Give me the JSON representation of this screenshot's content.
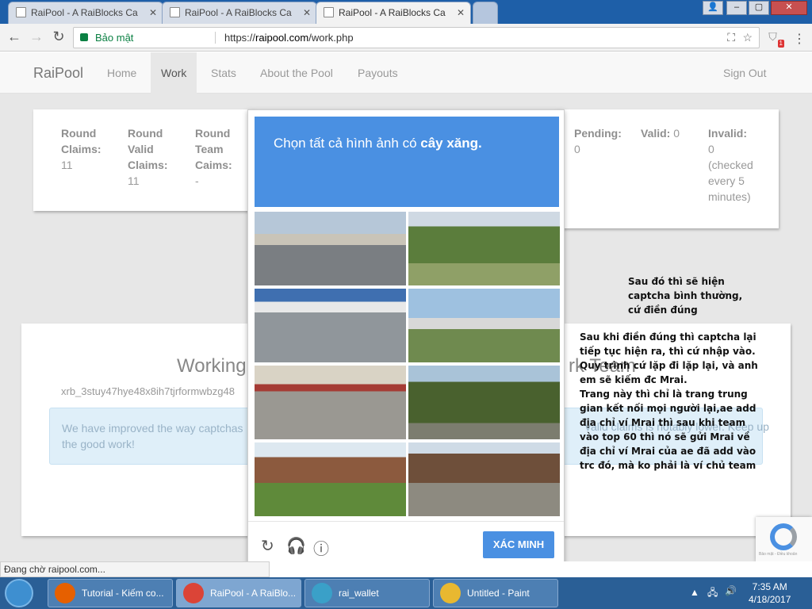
{
  "tabs": [
    {
      "title": "RaiPool - A RaiBlocks Ca"
    },
    {
      "title": "RaiPool - A RaiBlocks Ca"
    },
    {
      "title": "RaiPool - A RaiBlocks Ca"
    }
  ],
  "omnibox": {
    "secure_label": "Bảo mật",
    "url_scheme": "https://",
    "url_host": "raipool.com",
    "url_path": "/work.php",
    "ext_badge": "1"
  },
  "site": {
    "brand": "RaiPool",
    "nav": [
      "Home",
      "Work",
      "Stats",
      "About the Pool",
      "Payouts"
    ],
    "sign_out": "Sign Out"
  },
  "stats_left": [
    {
      "label": "Round Claims:",
      "value": "11"
    },
    {
      "label": "Round Valid Claims:",
      "value": "11"
    },
    {
      "label": "Round Team Caims:",
      "value": "-"
    }
  ],
  "stats_right": [
    {
      "label": "Pending:",
      "value": "0"
    },
    {
      "label": "Valid:",
      "value": "0"
    },
    {
      "label": "Invalid:",
      "value": "0",
      "note": "(checked every 5 minutes)"
    }
  ],
  "work": {
    "title_left": "Working",
    "title_right": "rk Team",
    "wallet": "xrb_3stuy47hye48x8ih7tjrformwbzg48",
    "alert_left": "We have improved the way captchas",
    "alert_left2": "the good work!",
    "alert_right": "valid claims is notably lower.  Keep up"
  },
  "captcha": {
    "prompt_pre": "Chọn tất cả hình ảnh có ",
    "prompt_target": "cây xăng.",
    "verify_label": "XÁC MINH",
    "reload_icon": "reload-icon",
    "audio_icon": "headphones-icon",
    "info_icon": "info-icon"
  },
  "recaptcha_badge_text": "Bảo mật - Điều khoản",
  "notes": {
    "note1": [
      "Sau đó thì sẽ hiện",
      "captcha bình thường,",
      "cứ điền đúng"
    ],
    "note2": [
      "Sau khi điền đúng thì captcha lại",
      "tiếp tục hiện ra, thì cứ nhập vào.",
      "Quy trình cứ lặp đi lặp lại, và anh",
      "em sẽ kiếm đc Mrai.",
      "Trang này thì chỉ là trang trung",
      "gian kết nối mọi người lại,ae add",
      "địa chỉ ví Mrai thì sau khi team",
      "vào top 60 thì nó sẽ gửi Mrai về",
      "địa chỉ ví Mrai của ae đã add vào",
      "trc đó, mà ko phải là ví chủ team"
    ]
  },
  "status_text": "Đang chờ raipool.com...",
  "taskbar": {
    "tasks": [
      {
        "label": "Tutorial - Kiếm co...",
        "color": "#e66000"
      },
      {
        "label": "RaiPool - A RaiBlo...",
        "color": "#db4437"
      },
      {
        "label": "rai_wallet",
        "color": "#3aa0c8"
      },
      {
        "label": "Untitled - Paint",
        "color": "#e8b830"
      }
    ],
    "time": "7:35 AM",
    "date": "4/18/2017"
  }
}
